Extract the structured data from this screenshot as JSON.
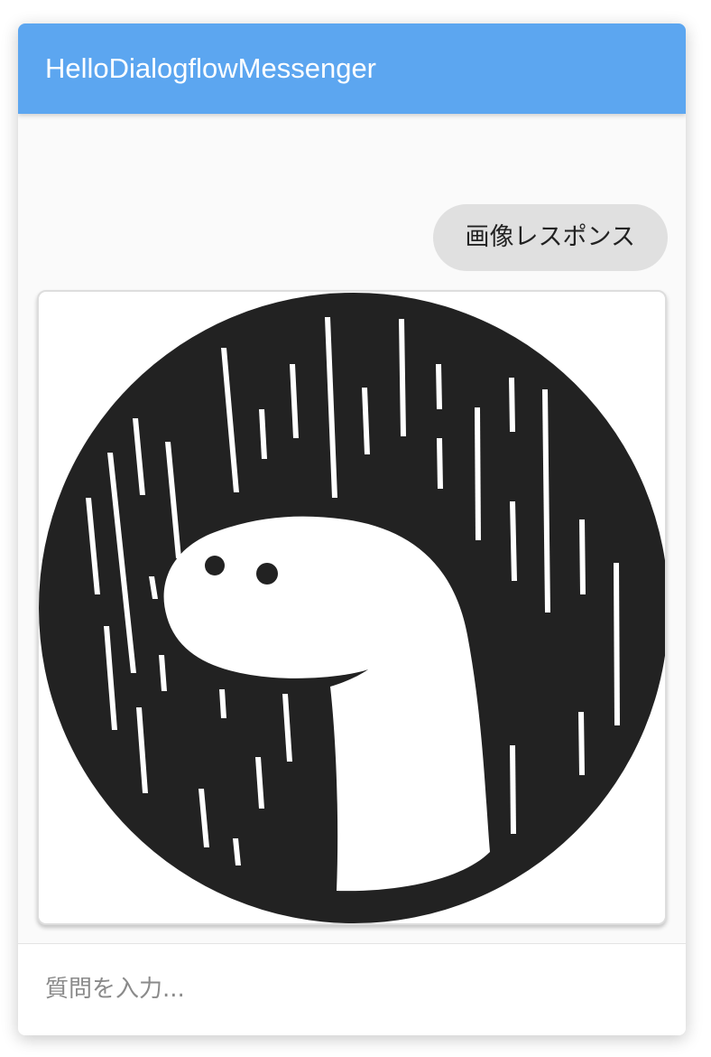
{
  "app": {
    "title": "HelloDialogflowMessenger",
    "accent_color": "#5ca6f0"
  },
  "messages": [
    {
      "from": "user",
      "text": "画像レスポンス"
    },
    {
      "from": "bot",
      "type": "image",
      "image_icon": "deno-dinosaur-rain-logo"
    }
  ],
  "input": {
    "placeholder": "質問を入力...",
    "value": ""
  }
}
